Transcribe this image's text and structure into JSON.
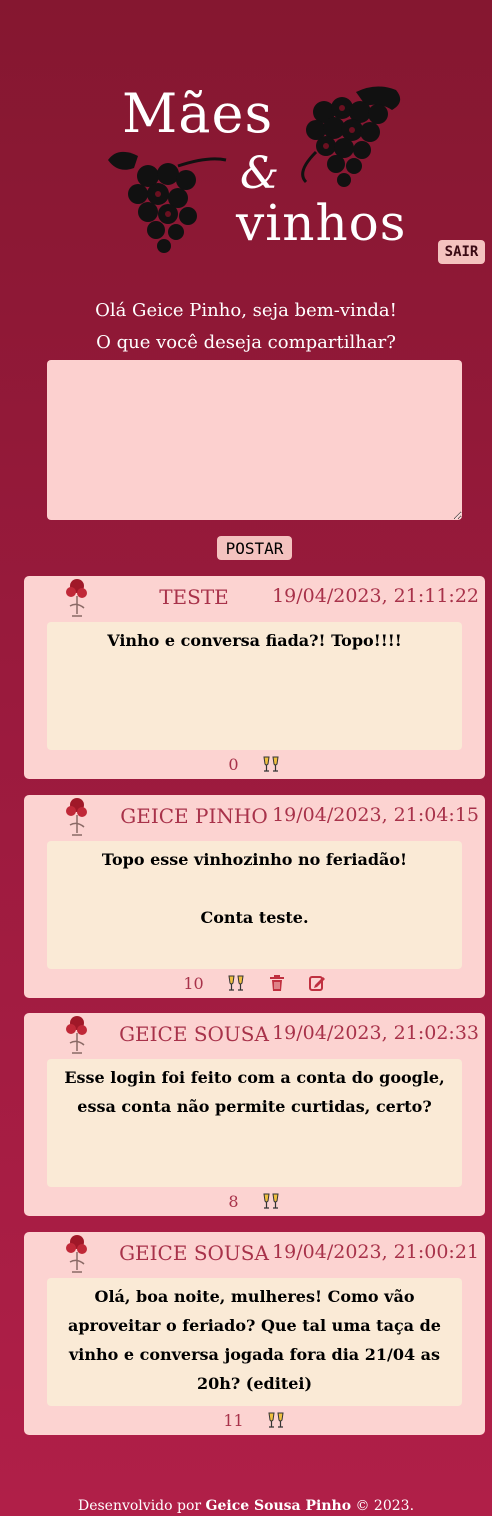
{
  "logo": {
    "line1": "Mães",
    "amp": "&",
    "line2": "vinhos"
  },
  "header": {
    "logout_label": "SAIR"
  },
  "greeting": {
    "line1": "Olá Geice Pinho, seja bem-vinda!",
    "line2": "O que você deseja compartilhar?"
  },
  "composer": {
    "value": "",
    "post_label": "POSTAR"
  },
  "posts": [
    {
      "author": "TESTE",
      "date": "19/04/2023, 21:11:22",
      "text": "Vinho e conversa fiada?! Topo!!!!",
      "likes": "0",
      "own": false
    },
    {
      "author": "GEICE PINHO",
      "date": "19/04/2023, 21:04:15",
      "text": "Topo esse vinhozinho no feriadão!\n\nConta teste.",
      "likes": "10",
      "own": true
    },
    {
      "author": "GEICE SOUSA",
      "date": "19/04/2023, 21:02:33",
      "text": "Esse login foi feito com a conta do google, essa conta não permite curtidas, certo?",
      "likes": "8",
      "own": false
    },
    {
      "author": "GEICE SOUSA",
      "date": "19/04/2023, 21:00:21",
      "text": "Olá, boa noite, mulheres! Como vão aproveitar o feriado? Que tal uma taça de vinho e conversa jogada fora dia 21/04 as 20h? (editei)",
      "likes": "11",
      "own": false
    }
  ],
  "footer": {
    "prefix": "Desenvolvido por",
    "author": "Geice Sousa Pinho",
    "suffix": "© 2023."
  },
  "colors": {
    "background": "#8a1832",
    "card": "#fcd3d1",
    "post_body": "#faead6",
    "accent": "#a8324a",
    "button": "#f4c2bf"
  },
  "icons": {
    "avatar": "wine-glass-avatar-icon",
    "like": "toast-glasses-icon",
    "delete": "trash-icon",
    "edit": "edit-icon"
  }
}
